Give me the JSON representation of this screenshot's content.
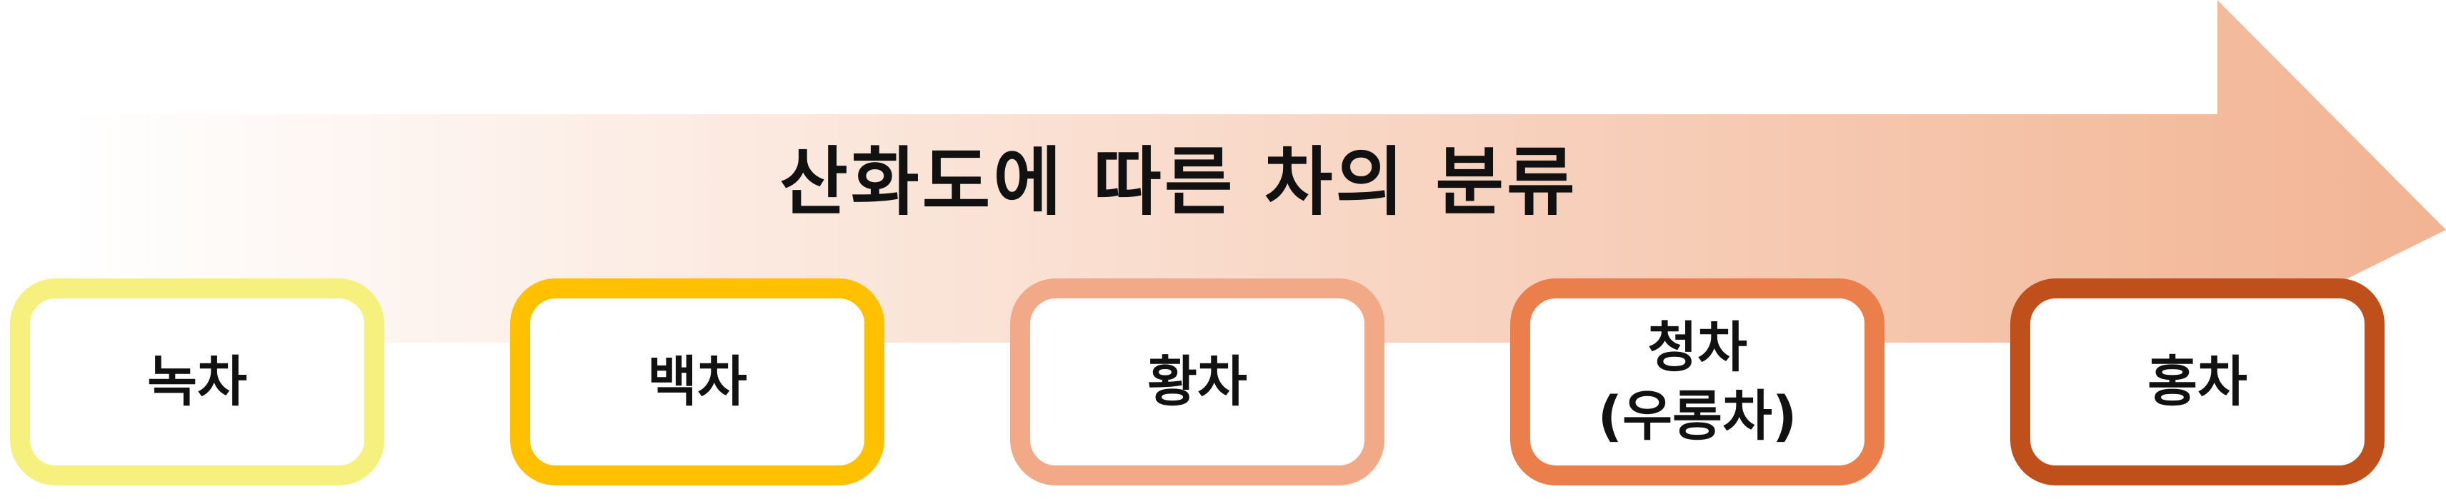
{
  "diagram": {
    "title": "산화도에 따른 차의 분류",
    "arrow_gradient": {
      "start": "#ffffff",
      "end": "#f2b493"
    },
    "stages": [
      {
        "label": "녹차",
        "border_color": "#f6f07e"
      },
      {
        "label": "백차",
        "border_color": "#ffc000"
      },
      {
        "label": "황차",
        "border_color": "#f2a987"
      },
      {
        "label": "청차\n(우롱차)",
        "border_color": "#ea7f4b"
      },
      {
        "label": "홍차",
        "border_color": "#c0501b"
      }
    ]
  }
}
